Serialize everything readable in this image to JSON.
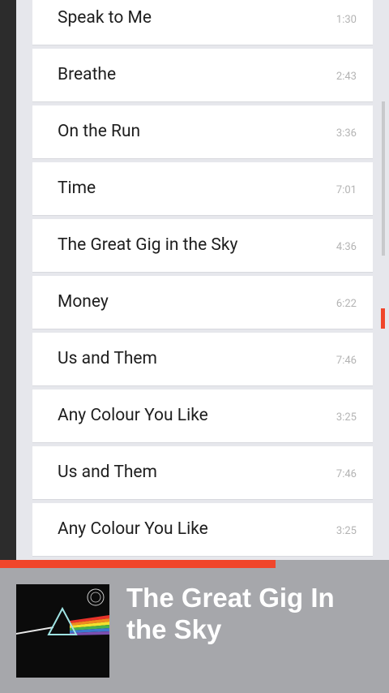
{
  "tracks": [
    {
      "title": "Speak to Me",
      "duration": "1:30"
    },
    {
      "title": "Breathe",
      "duration": "2:43"
    },
    {
      "title": "On the Run",
      "duration": "3:36"
    },
    {
      "title": "Time",
      "duration": "7:01"
    },
    {
      "title": "The Great Gig in the Sky",
      "duration": "4:36"
    },
    {
      "title": "Money",
      "duration": "6:22"
    },
    {
      "title": "Us and Them",
      "duration": "7:46"
    },
    {
      "title": "Any Colour You Like",
      "duration": "3:25"
    },
    {
      "title": "Us and Them",
      "duration": "7:46"
    },
    {
      "title": "Any Colour You Like",
      "duration": "3:25"
    }
  ],
  "player": {
    "now_playing_title": "The Great Gig In the Sky",
    "progress_fraction": 0.708,
    "album_art_icon": "prism-album-art"
  },
  "colors": {
    "accent": "#f0462b",
    "player_bg": "#a6a7ab",
    "list_bg": "#e6e7ec"
  }
}
